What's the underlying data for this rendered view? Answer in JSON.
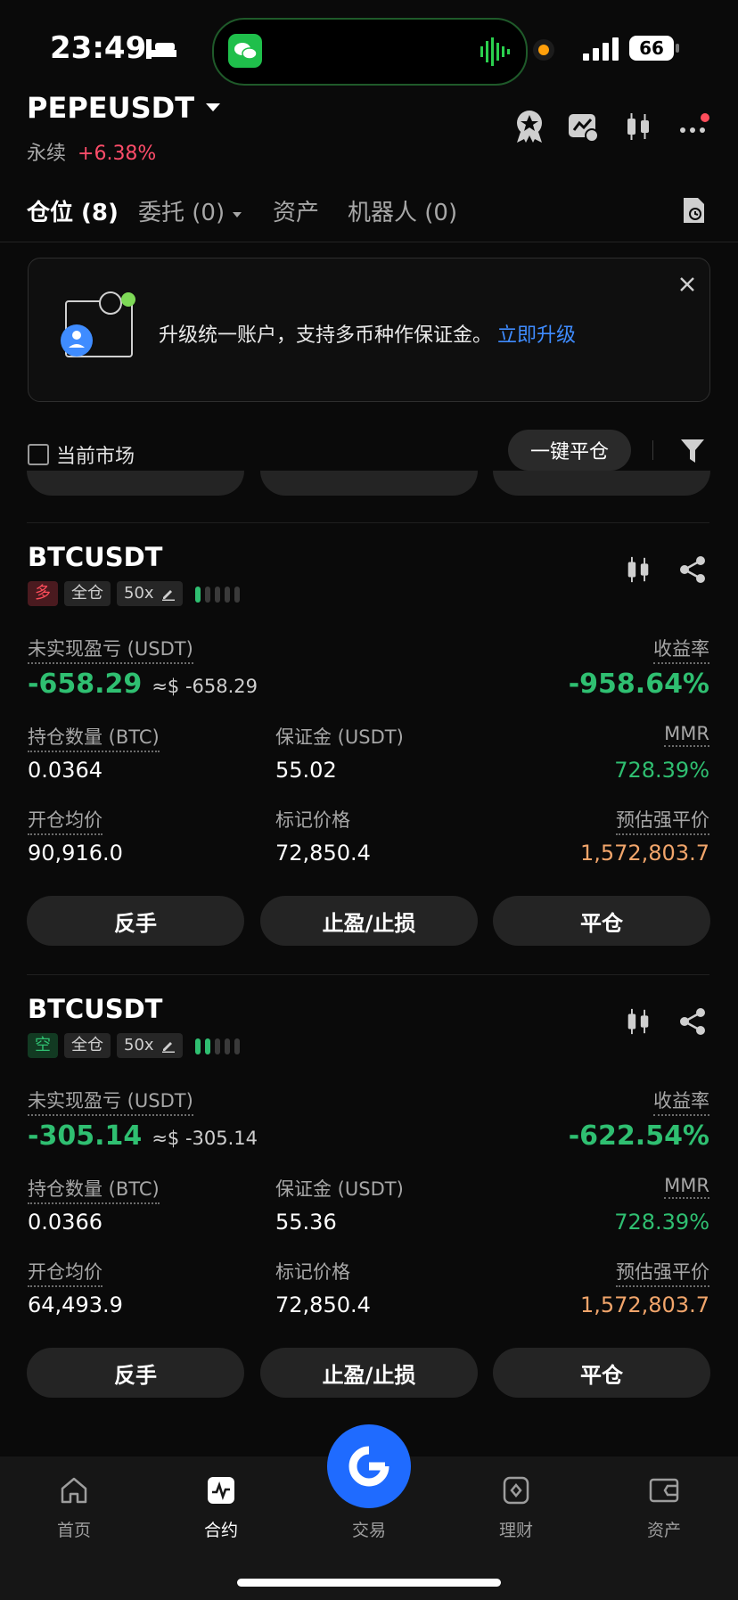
{
  "status_bar": {
    "time": "23:49",
    "battery": "66"
  },
  "header": {
    "symbol": "PEPEUSDT",
    "contract_type": "永续",
    "change": "+6.38%"
  },
  "tabs": [
    {
      "label": "仓位 (8)"
    },
    {
      "label": "委托 (0)"
    },
    {
      "label": "资产"
    },
    {
      "label": "机器人 (0)"
    }
  ],
  "banner": {
    "text": "升级统一账户，支持多币种作保证金。",
    "link": "立即升级"
  },
  "filter": {
    "current_market_label": "当前市场",
    "close_all_label": "一键平仓"
  },
  "positions": [
    {
      "symbol": "BTCUSDT",
      "side": "多",
      "margin_mode": "全仓",
      "leverage": "50x",
      "risk_level": 0.2,
      "pnl_label": "未实现盈亏 (USDT)",
      "pnl": "-658.29",
      "pnl_usd": "≈$ -658.29",
      "roe_label": "收益率",
      "roe": "-958.64%",
      "qty_label": "持仓数量 (BTC)",
      "qty": "0.0364",
      "margin_label": "保证金 (USDT)",
      "margin": "55.02",
      "mmr_label": "MMR",
      "mmr": "728.39%",
      "entry_label": "开仓均价",
      "entry": "90,916.0",
      "mark_label": "标记价格",
      "mark": "72,850.4",
      "liq_label": "预估强平价",
      "liq": "1,572,803.7",
      "btn_reverse": "反手",
      "btn_tpsl": "止盈/止损",
      "btn_close": "平仓"
    },
    {
      "symbol": "BTCUSDT",
      "side": "空",
      "margin_mode": "全仓",
      "leverage": "50x",
      "risk_level": 0.4,
      "pnl_label": "未实现盈亏 (USDT)",
      "pnl": "-305.14",
      "pnl_usd": "≈$ -305.14",
      "roe_label": "收益率",
      "roe": "-622.54%",
      "qty_label": "持仓数量 (BTC)",
      "qty": "0.0366",
      "margin_label": "保证金 (USDT)",
      "margin": "55.36",
      "mmr_label": "MMR",
      "mmr": "728.39%",
      "entry_label": "开仓均价",
      "entry": "64,493.9",
      "mark_label": "标记价格",
      "mark": "72,850.4",
      "liq_label": "预估强平价",
      "liq": "1,572,803.7",
      "btn_reverse": "反手",
      "btn_tpsl": "止盈/止损",
      "btn_close": "平仓"
    }
  ],
  "bottom_nav": [
    {
      "label": "首页",
      "icon": "home-icon"
    },
    {
      "label": "合约",
      "icon": "futures-icon"
    },
    {
      "label": "交易",
      "icon": "trade-logo-icon"
    },
    {
      "label": "理财",
      "icon": "earn-icon"
    },
    {
      "label": "资产",
      "icon": "wallet-icon"
    }
  ],
  "colors": {
    "green": "#2fbf71",
    "red": "#ff4d6a",
    "orange": "#f1a56b",
    "blue": "#3f8cff",
    "accent_button": "#1f6bff"
  }
}
